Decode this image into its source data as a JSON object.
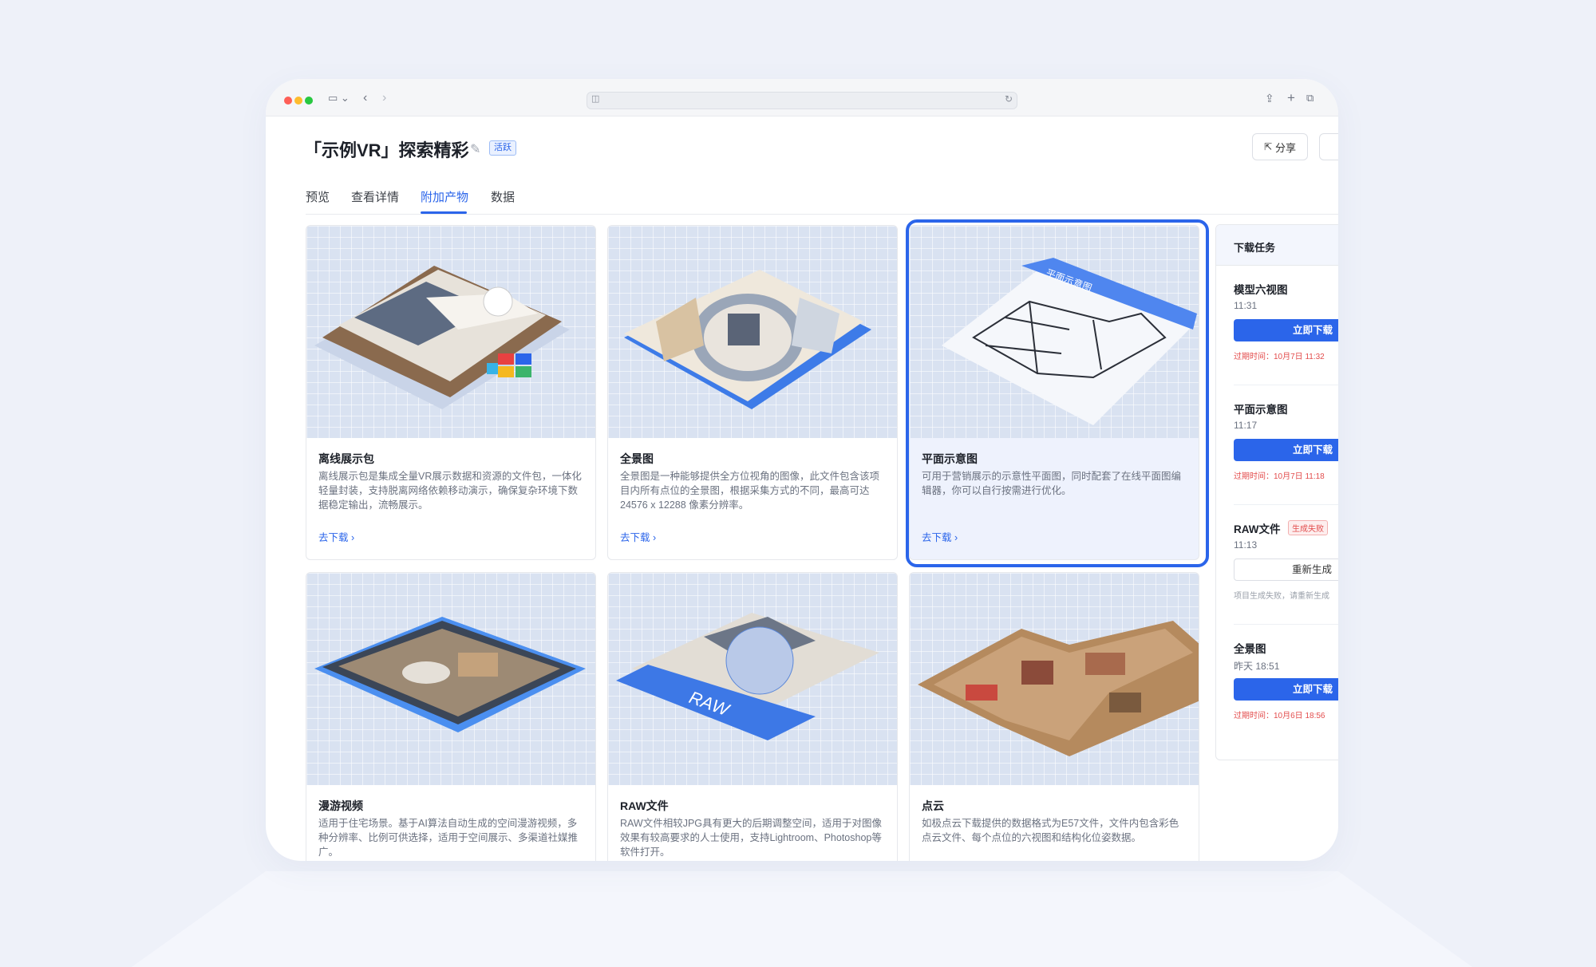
{
  "page": {
    "title": "「示例VR」探索精彩",
    "status_badge": "活跃",
    "share_label": "分享"
  },
  "tabs": [
    {
      "label": "预览",
      "active": false
    },
    {
      "label": "查看详情",
      "active": false
    },
    {
      "label": "附加产物",
      "active": true
    },
    {
      "label": "数据",
      "active": false
    }
  ],
  "cards": [
    {
      "title": "离线展示包",
      "desc": "离线展示包是集成全量VR展示数据和资源的文件包，一体化轻量封装，支持脱离网络依赖移动演示，确保复杂环境下数据稳定输出，流畅展示。",
      "link": "去下载",
      "thumb_label": ""
    },
    {
      "title": "全景图",
      "desc": "全景图是一种能够提供全方位视角的图像，此文件包含该项目内所有点位的全景图，根据采集方式的不同，最高可达 24576 x 12288 像素分辨率。",
      "link": "去下载",
      "thumb_label": ""
    },
    {
      "title": "平面示意图",
      "desc": "可用于营销展示的示意性平面图，同时配套了在线平面图编辑器，你可以自行按需进行优化。",
      "link": "去下载",
      "thumb_label": "平面示意图",
      "selected": true
    },
    {
      "title": "漫游视频",
      "desc": "适用于住宅场景。基于AI算法自动生成的空间漫游视频，多种分辨率、比例可供选择，适用于空间展示、多渠道社媒推广。",
      "link": "",
      "thumb_label": ""
    },
    {
      "title": "RAW文件",
      "desc": "RAW文件相较JPG具有更大的后期调整空间，适用于对图像效果有较高要求的人士使用，支持Lightroom、Photoshop等软件打开。",
      "link": "",
      "thumb_label": "RAW"
    },
    {
      "title": "点云",
      "desc": "如极点云下载提供的数据格式为E57文件，文件内包含彩色点云文件、每个点位的六视图和结构化位姿数据。",
      "link": "",
      "thumb_label": ""
    }
  ],
  "download_panel": {
    "title": "下载任务",
    "tasks": [
      {
        "name": "模型六视图",
        "time": "11:31",
        "action": "立即下载",
        "note": "过期时间：10月7日 11:32",
        "failed_label": ""
      },
      {
        "name": "平面示意图",
        "time": "11:17",
        "action": "立即下载",
        "note": "过期时间：10月7日 11:18",
        "failed_label": ""
      },
      {
        "name": "RAW文件",
        "time": "11:13",
        "action": "重新生成",
        "note": "项目生成失败，请重新生成",
        "failed_label": "生成失败"
      },
      {
        "name": "全景图",
        "time": "昨天 18:51",
        "action": "立即下载",
        "note": "过期时间：10月6日 18:56",
        "failed_label": ""
      }
    ]
  }
}
